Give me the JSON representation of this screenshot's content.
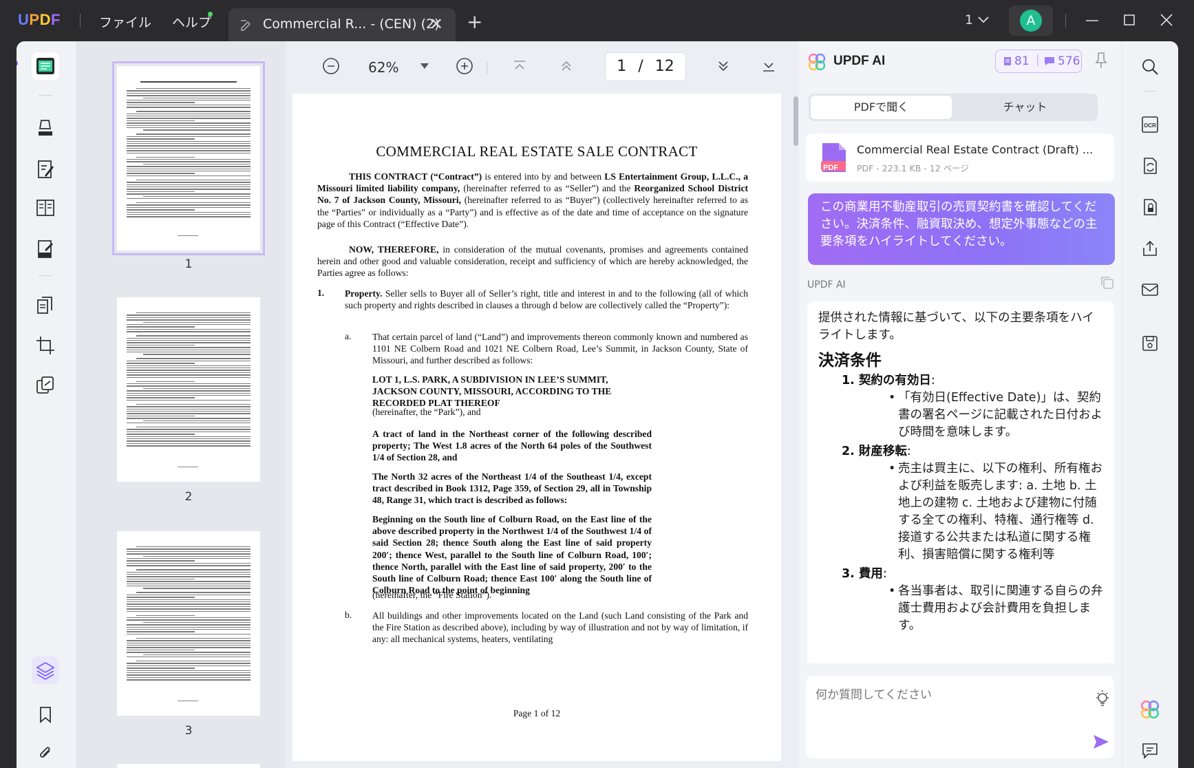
{
  "titlebar": {
    "app_logo": "UPDF",
    "menus": [
      "ファイル",
      "ヘルプ"
    ],
    "tab_title": "Commercial R... - (CEN) (2)",
    "window_count": "1",
    "avatar_letter": "A"
  },
  "viewer": {
    "zoom": "62%",
    "current_page": "1",
    "page_sep": "/",
    "total_pages": "12"
  },
  "thumbnails": [
    {
      "number": "1",
      "selected": true
    },
    {
      "number": "2",
      "selected": false
    },
    {
      "number": "3",
      "selected": false
    }
  ],
  "document": {
    "title": "COMMERCIAL REAL ESTATE SALE CONTRACT",
    "p1_b1": "THIS CONTRACT (“Contract”)",
    "p1_t1": " is entered into by and between ",
    "p1_b2": "LS Entertainment Group, L.L.C., a Missouri limited liability company,",
    "p1_t2": " (hereinafter referred to as “Seller”) and the ",
    "p1_b3": "Reorganized School District No. 7 of Jackson County, Missouri,",
    "p1_t3": " (hereinafter referred to as “Buyer”) (collectively hereinafter referred to as the “Parties” or individually as a “Party”) and is effective as of the date and time of acceptance on the signature page of this Contract (“Effective Date”).",
    "p2_b": "NOW, THEREFORE,",
    "p2_t": " in consideration of the mutual covenants, promises and agreements contained herein and other good and valuable consideration, receipt and sufficiency of which are hereby acknowledged, the Parties agree as follows:",
    "s1_num": "1.",
    "s1_b": "Property.",
    "s1_t": " Seller sells to Buyer all of Seller’s right, title and interest in and to the following (all of which such property and rights described in clauses a through d below are collectively called the “Property”):",
    "a_lbl": "a.",
    "a_text": "That certain parcel of land (“Land”) and improvements thereon commonly known and numbered as 1101 NE Colbern Road and 1021 NE Colbern Road, Lee’s Summit, in Jackson County, State of Missouri, and further described as follows:",
    "lot_b": "LOT 1, L.S. PARK, A SUBDIVISION IN LEE’S SUMMIT, JACKSON COUNTY, MISSOURI, ACCORDING TO THE RECORDED PLAT THEREOF",
    "lot_t": "(hereinafter, the “Park”), and",
    "tract1": "A tract of land in the Northeast corner of the following described property; The West 1.8 acres of the North 64 poles of the Southwest 1/4 of Section 28, and",
    "tract2": "The North 32 acres of the Northeast 1/4 of the Southeast 1/4, except tract described in Book 1312, Page 359, of Section 29, all in Township 48, Range 31, which tract is described as follows:",
    "tract3": "Beginning on the South line of Colburn Road, on the East line of the above described property in the Northwest 1/4 of the Southwest 1/4 of said Section 28; thence South along the East line of said property 200′; thence West, parallel to the South line of Colburn Road, 100′; thence North, parallel with the East line of said property, 200′ to the South line of Colburn Road; thence East 100′ along the South line of Colburn Road to the point of beginning",
    "tract3_t": "(hereinafter, the “Fire Station”).",
    "b_lbl": "b.",
    "b_text": "All buildings and other improvements located on the Land (such Land consisting of the Park and the Fire Station as described above), including by way of illustration and not by way of limitation, if any: all mechanical systems, heaters, ventilating",
    "footer": "Page 1 of 12"
  },
  "ai": {
    "title": "UPDF AI",
    "credit1": "81",
    "credit2": "576",
    "tab_pdf": "PDFで聞く",
    "tab_chat": "チャット",
    "file_icon_label": "PDF",
    "file_name": "Commercial Real Estate Contract (Draft) ...",
    "file_meta": "PDF - 223.1 KB - 12 ページ",
    "user_prompt": "この商業用不動産取引の売買契約書を確認してください。決済条件、融資取決め、想定外事態などの主要条項をハイライトしてください。",
    "responder": "UPDF AI",
    "answer_intro": "提供された情報に基づいて、以下の主要条項をハイライトします。",
    "answer_heading": "決済条件",
    "item1": "1. 契約の有効日",
    "item1_bullet": "「有効日(Effective Date)」は、契約書の署名ページに記載された日付および時間を意味します。",
    "item2": "2. 財産移転",
    "item2_bullet": "売主は買主に、以下の権利、所有権および利益を販売します: a. 土地 b. 土地上の建物 c. 土地および建物に付随する全ての権利、特権、通行権等 d. 接道する公共または私道に関する権利、損害賠償に関する権利等",
    "item3": "3. 費用",
    "item3_bullet": "各当事者は、取引に関連する自らの弁護士費用および会計費用を負担します。",
    "colon": ":",
    "input_placeholder": "何か質問してください"
  },
  "colors": {
    "accent": "#8a6cf0",
    "titlebar_bg": "#2b2b2d",
    "prompt_gradient_start": "#a06cf3",
    "prompt_gradient_end": "#8c85f8"
  }
}
